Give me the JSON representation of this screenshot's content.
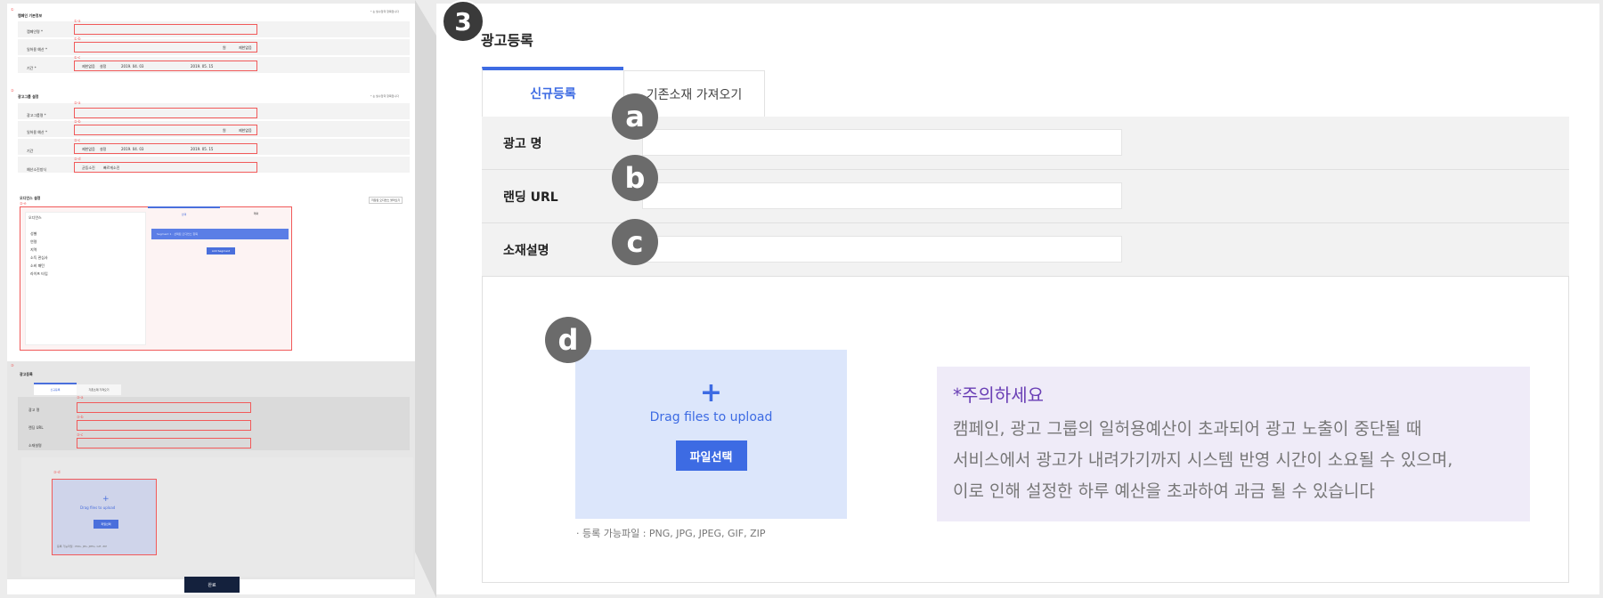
{
  "left": {
    "sec1": {
      "num": "①",
      "title": "캠페인 기본정보",
      "note": "* 는 필수입력 항목입니다",
      "rows": [
        {
          "tag": "①-a",
          "label": "캠페인명 *"
        },
        {
          "tag": "①-b",
          "label": "일허용 예산 *",
          "unit": "원",
          "check": "제한없음"
        },
        {
          "tag": "①-c",
          "label": "기간 *",
          "opt1": "제한없음",
          "opt2": "설정",
          "d1": "2019. 04. 03",
          "d2": "2019. 05. 15"
        }
      ]
    },
    "sec2": {
      "num": "②",
      "title": "광고그룹 설정",
      "note": "* 는 필수입력 항목입니다",
      "rows": [
        {
          "tag": "②-a",
          "label": "광고그룹명 *"
        },
        {
          "tag": "②-b",
          "label": "일허용 예산 *",
          "unit": "원",
          "check": "제한없음"
        },
        {
          "tag": "②-c",
          "label": "기간",
          "opt1": "제한없음",
          "opt2": "설정",
          "d1": "2019. 04. 03",
          "d2": "2019. 05. 15"
        },
        {
          "tag": "②-d",
          "label": "예산소진방식",
          "opt1": "균등소진",
          "opt2": "빠르게소진"
        }
      ]
    },
    "audience": {
      "title": "오디언스 설정",
      "btn": "저장된 오디언스 불러오기",
      "tag": "②-e",
      "col": "오디언스",
      "tab1": "선택",
      "tab2": "제외",
      "items": [
        "성별",
        "연령",
        "지역",
        "소득 관심사",
        "소비 패턴",
        "라이프 타입"
      ],
      "selected": "Segment 1 · 선택된 오디언스 항목",
      "add": "Add Segment"
    },
    "sec3": {
      "num": "③",
      "title": "광고등록",
      "tab1": "신규등록",
      "tab2": "기존소재 가져오기",
      "rows": [
        {
          "tag": "③-a",
          "label": "광고 명"
        },
        {
          "tag": "③-b",
          "label": "랜딩 URL"
        },
        {
          "tag": "③-c",
          "label": "소재설명"
        }
      ],
      "dtag": "③-d",
      "drop": "Drag files to upload",
      "pick": "파일선택",
      "types": "등록 가능파일 : PNG, JPG, JPEG, GIF, ZIP"
    },
    "done": "완료"
  },
  "main": {
    "step": "3",
    "title": "광고등록",
    "tabs": [
      "신규등록",
      "기존소재 가져오기"
    ],
    "fields": [
      {
        "badge": "a",
        "label": "광고 명",
        "value": ""
      },
      {
        "badge": "b",
        "label": "랜딩 URL",
        "value": ""
      },
      {
        "badge": "c",
        "label": "소재설명",
        "value": ""
      }
    ],
    "upload": {
      "badge": "d",
      "plus": "+",
      "text": "Drag files to upload",
      "button": "파일선택",
      "types": "· 등록 가능파일 : PNG, JPG, JPEG, GIF, ZIP"
    },
    "notice": {
      "title": "*주의하세요",
      "lines": [
        "캠페인, 광고 그룹의 일허용예산이 초과되어 광고 노출이 중단될 때",
        "서비스에서 광고가 내려가기까지 시스템 반영 시간이 소요될 수 있으며,",
        "이로 인해 설정한 하루 예산을 초과하여 과금 될 수 있습니다"
      ]
    }
  },
  "colors": {
    "accent": "#3d6be3",
    "highlight": "#f15a5a",
    "notice": "#6a3fb5",
    "done": "#14213d"
  }
}
